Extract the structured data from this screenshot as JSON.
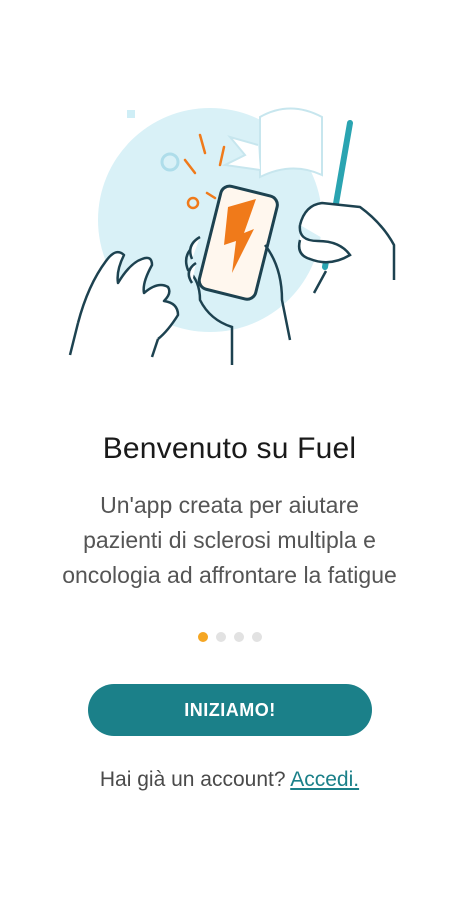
{
  "onboarding": {
    "title": "Benvenuto su Fuel",
    "subtitle_lines": [
      "Un'app creata per aiutare",
      "pazienti di sclerosi multipla e",
      "oncologia ad affrontare la fatigue"
    ],
    "pagination": {
      "total": 4,
      "active": 1
    },
    "cta_label": "INIZIAMO!",
    "login_prompt": "Hai già un account?",
    "login_link": "Accedi."
  },
  "colors": {
    "accent": "#1b8089",
    "active_dot": "#f5a623",
    "inactive_dot": "#e2e2e2",
    "illustration_bg": "#d9f1f7",
    "illustration_line": "#1d4250",
    "illustration_flame": "#f07a1a"
  }
}
